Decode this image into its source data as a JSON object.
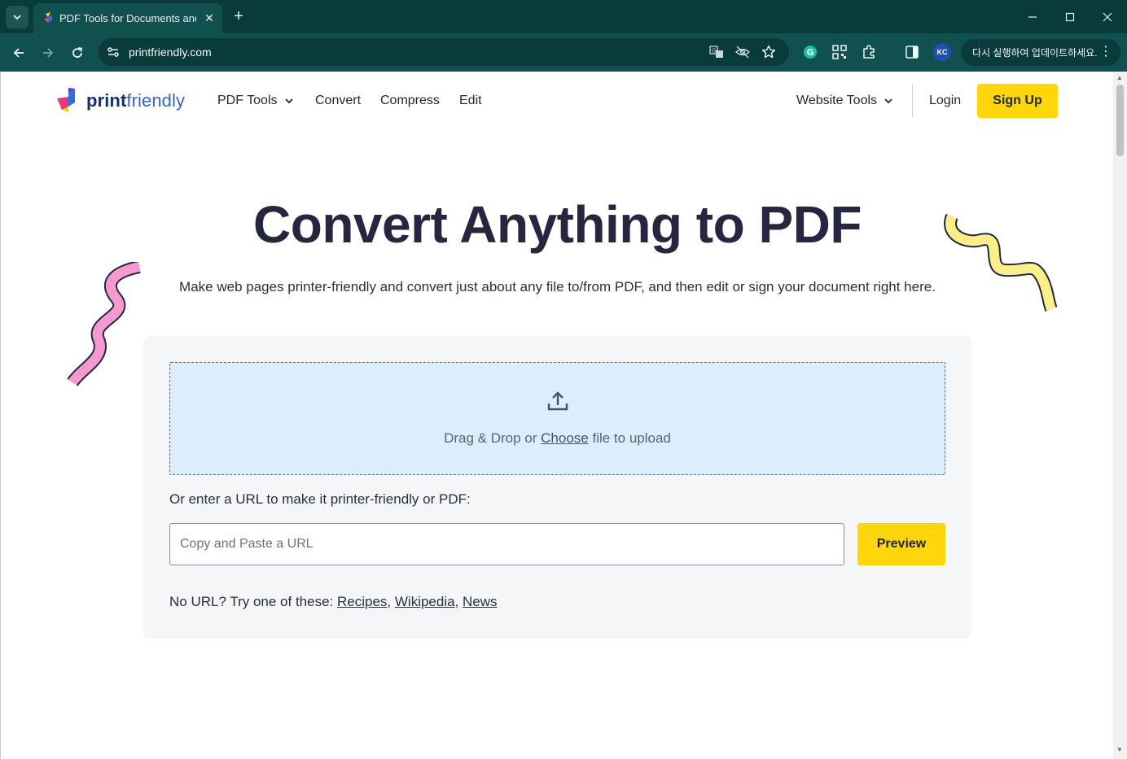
{
  "browser": {
    "tab_title": "PDF Tools for Documents and",
    "url": "printfriendly.com",
    "profile_initials": "KC",
    "update_label": "다시 실행하여 업데이트하세요."
  },
  "site": {
    "logo_bold": "print",
    "logo_light": "friendly",
    "nav": {
      "pdf_tools": "PDF Tools",
      "convert": "Convert",
      "compress": "Compress",
      "edit": "Edit",
      "website_tools": "Website Tools",
      "login": "Login",
      "signup": "Sign Up"
    }
  },
  "hero": {
    "title": "Convert Anything to PDF",
    "subtitle": "Make web pages printer-friendly and convert just about any file to/from PDF, and then edit or sign your document right here."
  },
  "upload": {
    "prefix": "Drag & Drop or ",
    "choose": "Choose",
    "suffix": " file to upload"
  },
  "url_form": {
    "label": "Or enter a URL to make it printer-friendly or PDF:",
    "placeholder": "Copy and Paste a URL",
    "value": "",
    "preview": "Preview"
  },
  "try": {
    "prefix": "No URL? Try one of these: ",
    "links": [
      "Recipes",
      "Wikipedia",
      "News"
    ]
  },
  "colors": {
    "chrome_dark": "#0a3b3b",
    "chrome_toolbar": "#10504f",
    "accent_yellow": "#ffd60a",
    "dropzone_blue": "#dbeefd",
    "heading": "#262640"
  }
}
